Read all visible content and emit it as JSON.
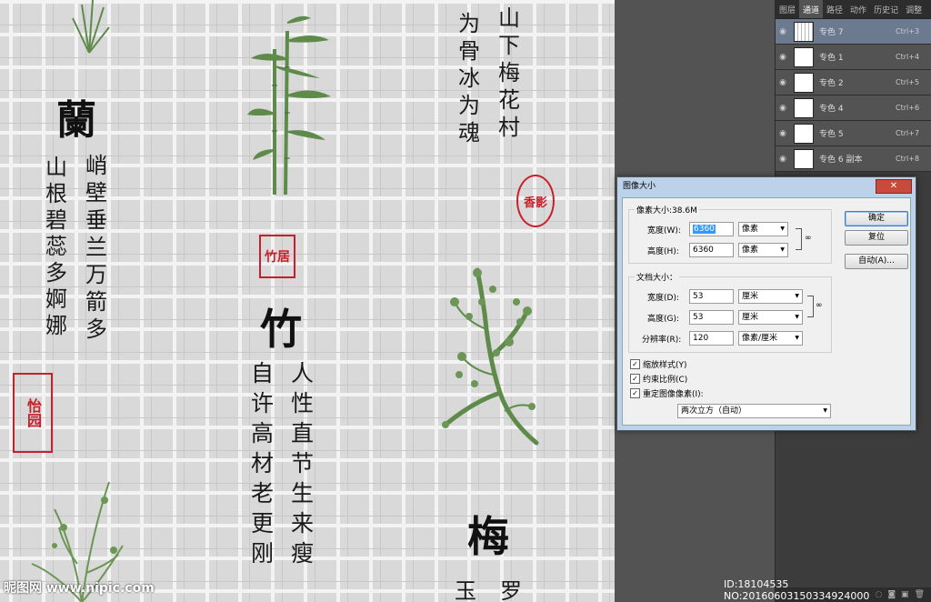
{
  "canvas": {
    "col1": {
      "heading": "蘭",
      "col_a": [
        "山",
        "根",
        "碧",
        "蕊",
        "多",
        "婀",
        "娜"
      ],
      "col_b": [
        "峭",
        "壁",
        "垂",
        "兰",
        "万",
        "箭",
        "多"
      ],
      "seal": "怡园"
    },
    "col2": {
      "heading": "竹",
      "col_a": [
        "自",
        "许",
        "高",
        "材",
        "老",
        "更",
        "刚"
      ],
      "col_b": [
        "人",
        "性",
        "直",
        "节",
        "生",
        "来",
        "瘦"
      ],
      "seal": "竹居"
    },
    "col3": {
      "col_a": [
        "为",
        "骨",
        "冰",
        "为",
        "魂"
      ],
      "col_b": [
        "山",
        "下",
        "梅",
        "花",
        "村"
      ],
      "heading": "梅",
      "bottom_chars": [
        "玉",
        "罗"
      ],
      "seal": "香影"
    }
  },
  "panel": {
    "tabs": [
      "图层",
      "通道",
      "路径",
      "动作",
      "历史记",
      "调整"
    ],
    "active_tab": "通道",
    "channels": [
      {
        "name": "专色 7",
        "shortcut": "Ctrl+3",
        "selected": true
      },
      {
        "name": "专色 1",
        "shortcut": "Ctrl+4",
        "selected": false
      },
      {
        "name": "专色 2",
        "shortcut": "Ctrl+5",
        "selected": false
      },
      {
        "name": "专色 4",
        "shortcut": "Ctrl+6",
        "selected": false
      },
      {
        "name": "专色 5",
        "shortcut": "Ctrl+7",
        "selected": false
      },
      {
        "name": "专色 6 副本",
        "shortcut": "Ctrl+8",
        "selected": false
      }
    ]
  },
  "dialog": {
    "title": "图像大小",
    "pixel_dims_label": "像素大小:38.6M",
    "width_label": "宽度(W):",
    "width_value": "6360",
    "width_unit": "像素",
    "height_label": "高度(H):",
    "height_value": "6360",
    "height_unit": "像素",
    "doc_size_label": "文档大小：",
    "doc_width_label": "宽度(D):",
    "doc_width_value": "53",
    "doc_width_unit": "厘米",
    "doc_height_label": "高度(G):",
    "doc_height_value": "53",
    "doc_height_unit": "厘米",
    "resolution_label": "分辨率(R):",
    "resolution_value": "120",
    "resolution_unit": "像素/厘米",
    "scale_styles": "缩放样式(Y)",
    "constrain": "约束比例(C)",
    "resample": "重定图像像素(I):",
    "resample_method": "两次立方（自动）",
    "ok": "确定",
    "reset": "复位",
    "auto": "自动(A)...",
    "close": "✕"
  },
  "watermark": {
    "left": "昵图网 www.nipic.com",
    "right": "ID:18104535 NO:20160603150334924000"
  }
}
